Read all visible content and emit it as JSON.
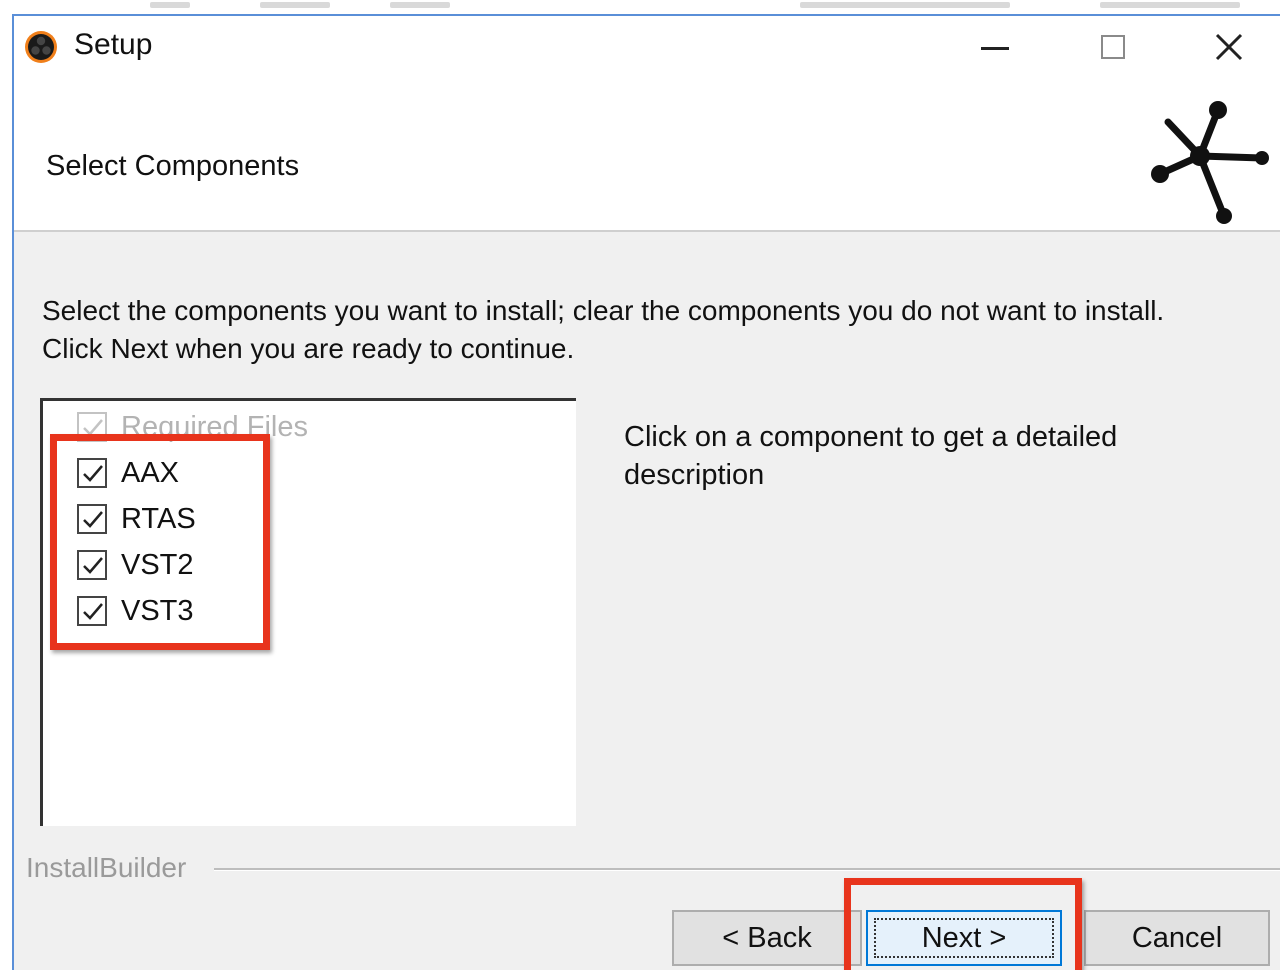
{
  "window": {
    "title": "Setup",
    "controls": {
      "minimize": "minimize",
      "maximize": "maximize",
      "close": "close"
    }
  },
  "header": {
    "title": "Select Components"
  },
  "content": {
    "instructions": "Select the components you want to install; clear the components you do not want to install. Click Next when you are ready to continue.",
    "description": "Click on a component to get a detailed description",
    "components": [
      {
        "label": "Required Files",
        "checked": true,
        "enabled": false
      },
      {
        "label": "AAX",
        "checked": true,
        "enabled": true
      },
      {
        "label": "RTAS",
        "checked": true,
        "enabled": true
      },
      {
        "label": "VST2",
        "checked": true,
        "enabled": true
      },
      {
        "label": "VST3",
        "checked": true,
        "enabled": true
      }
    ]
  },
  "footer": {
    "brand": "InstallBuilder",
    "back_label": "< Back",
    "next_label": "Next >",
    "cancel_label": "Cancel"
  },
  "colors": {
    "highlight": "#e8341c",
    "accent": "#0078d7",
    "content_bg": "#f0f0f0"
  },
  "icons": {
    "app": "obs-like-app-icon",
    "logo": "molecule-star-logo-icon",
    "close": "close-icon",
    "minimize": "minimize-icon",
    "maximize": "maximize-icon",
    "checkbox": "checkmark-icon"
  }
}
